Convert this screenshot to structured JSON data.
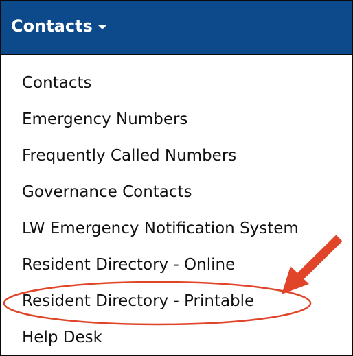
{
  "menu": {
    "title": "Contacts",
    "items": [
      {
        "label": "Contacts"
      },
      {
        "label": "Emergency Numbers"
      },
      {
        "label": "Frequently Called Numbers"
      },
      {
        "label": "Governance Contacts"
      },
      {
        "label": "LW Emergency Notification System"
      },
      {
        "label": "Resident Directory - Online"
      },
      {
        "label": "Resident Directory - Printable"
      },
      {
        "label": "Help Desk"
      }
    ]
  },
  "annotation": {
    "color": "#e0452a",
    "highlighted_item": "Resident Directory - Printable"
  },
  "colors": {
    "header_bg": "#0c4a8c",
    "header_text": "#ffffff",
    "item_text": "#111111"
  },
  "icons": {
    "caret": "chevron-down-icon",
    "arrow": "arrow-icon"
  }
}
